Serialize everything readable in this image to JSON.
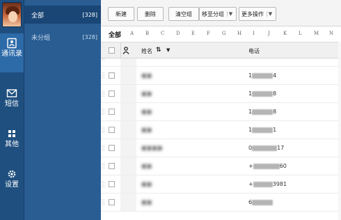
{
  "rail": {
    "items": [
      {
        "label": "通讯录",
        "icon": "contacts-icon",
        "active": true
      },
      {
        "label": "短信",
        "icon": "envelope-icon"
      },
      {
        "label": "其他",
        "icon": "grid-icon"
      },
      {
        "label": "设置",
        "icon": "gear-icon"
      }
    ]
  },
  "groups": {
    "items": [
      {
        "label": "全部",
        "count": "[328]",
        "active": true
      },
      {
        "label": "未分组",
        "count": "[328]"
      }
    ]
  },
  "toolbar": {
    "new_label": "新建",
    "delete_label": "删除",
    "clear_group_label": "清空组",
    "move_group_label": "移至分组",
    "more_label": "更多操作"
  },
  "alpha": {
    "all_label": "全部",
    "letters": [
      "A",
      "B",
      "C",
      "D",
      "E",
      "F",
      "G",
      "H",
      "I",
      "J",
      "K",
      "L",
      "M",
      "N"
    ]
  },
  "table": {
    "name_header": "姓名",
    "phone_header": "电话",
    "rows": [
      {
        "name": "·",
        "phone_prefix": "",
        "phone_suffix": ""
      },
      {
        "name": "■■",
        "phone_prefix": "1",
        "phone_suffix": "4"
      },
      {
        "name": "■■",
        "phone_prefix": "1",
        "phone_suffix": "8"
      },
      {
        "name": "■■",
        "phone_prefix": "1",
        "phone_suffix": "8"
      },
      {
        "name": "■■",
        "phone_prefix": "1",
        "phone_suffix": "1"
      },
      {
        "name": "■■■■",
        "phone_prefix": "0",
        "phone_suffix": "17"
      },
      {
        "name": "■■",
        "phone_prefix": "+",
        "phone_suffix": "60"
      },
      {
        "name": "■■",
        "phone_prefix": "+",
        "phone_suffix": "3981"
      },
      {
        "name": "■■",
        "phone_prefix": "6",
        "phone_suffix": ""
      }
    ]
  },
  "colors": {
    "rail_bg": "#1f4f7f",
    "rail_active": "#2d6aa8",
    "group_bg": "#2a5d92",
    "group_active": "#1a4676"
  }
}
